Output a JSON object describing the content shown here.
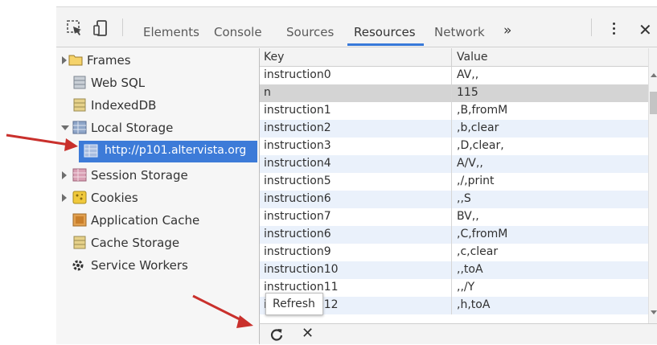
{
  "toolbar": {
    "tabs": [
      {
        "label": "Elements"
      },
      {
        "label": "Console"
      },
      {
        "label": "Sources"
      },
      {
        "label": "Resources"
      },
      {
        "label": "Network"
      }
    ],
    "active_tab": "Resources",
    "more_label": "»",
    "close_label": "✕",
    "icons": [
      "inspect-icon",
      "device-mode-icon",
      "kebab-menu-icon",
      "close-icon"
    ]
  },
  "sidebar": {
    "items": [
      {
        "label": "Frames",
        "icon": "folder-icon",
        "expander": "collapsed"
      },
      {
        "label": "Web SQL",
        "icon": "database-icon"
      },
      {
        "label": "IndexedDB",
        "icon": "database-icon"
      },
      {
        "label": "Local Storage",
        "icon": "storage-grid-icon",
        "expander": "expanded"
      },
      {
        "label": "http://p101.altervista.org",
        "icon": "storage-grid-icon",
        "selected": true
      },
      {
        "label": "Session Storage",
        "icon": "storage-grid-icon",
        "expander": "collapsed"
      },
      {
        "label": "Cookies",
        "icon": "cookie-icon",
        "expander": "collapsed"
      },
      {
        "label": "Application Cache",
        "icon": "app-cache-icon"
      },
      {
        "label": "Cache Storage",
        "icon": "database-icon"
      },
      {
        "label": "Service Workers",
        "icon": "gear-icon"
      }
    ]
  },
  "grid": {
    "header": {
      "key": "Key",
      "value": "Value"
    },
    "rows": [
      {
        "key": "instruction0",
        "value": "AV,,"
      },
      {
        "key": "n",
        "value": "115"
      },
      {
        "key": "instruction1",
        "value": ",B,fromM"
      },
      {
        "key": "instruction2",
        "value": ",b,clear"
      },
      {
        "key": "instruction3",
        "value": ",D,clear,"
      },
      {
        "key": "instruction4",
        "value": "A/V,,"
      },
      {
        "key": "instruction5",
        "value": ",/,print"
      },
      {
        "key": "instruction6",
        "value": ",,S"
      },
      {
        "key": "instruction7",
        "value": "BV,,"
      },
      {
        "key": "instruction6",
        "value": ",C,fromM"
      },
      {
        "key": "instruction9",
        "value": ",c,clear"
      },
      {
        "key": "instruction10",
        "value": ",,toA"
      },
      {
        "key": "instruction11",
        "value": ",,/Y"
      },
      {
        "key": "instruction12",
        "value": ",h,toA"
      }
    ],
    "selected_row": 1
  },
  "tooltip": {
    "text": "Refresh"
  },
  "bottombar": {
    "icons": [
      "refresh-icon",
      "delete-icon"
    ],
    "delete_label": "✕"
  },
  "colors": {
    "selection": "#3d7bd8",
    "annotation_arrow": "#c9302c",
    "active_tab_underline": "#3879d9",
    "row_alt": "#eaf1fb"
  }
}
